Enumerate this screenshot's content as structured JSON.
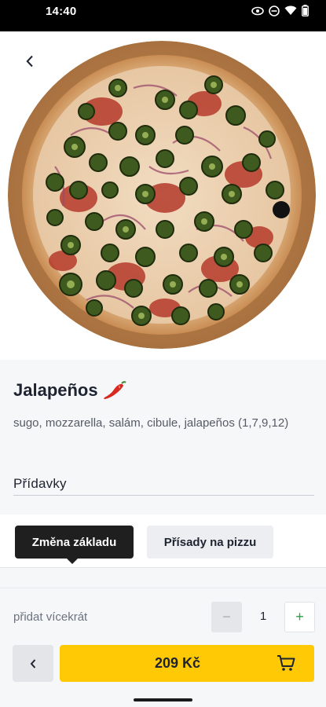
{
  "status_bar": {
    "time": "14:40",
    "icons": [
      "eye-icon",
      "dnd-icon",
      "wifi-icon",
      "battery-icon"
    ]
  },
  "product": {
    "title": "Jalapeños",
    "title_emoji": "chili-pepper-icon",
    "description": "sugo, mozzarella, salám, cibule, jalapeños (1,7,9,12)"
  },
  "extras": {
    "section_label": "Přídavky",
    "tooltip_label": "Změna základu",
    "toppings_label": "Přísady na pizzu"
  },
  "quantity": {
    "label": "přidat vícekrát",
    "value": "1",
    "minus": "−",
    "plus": "+"
  },
  "cart": {
    "price_label": "209 Kč"
  },
  "colors": {
    "accent": "#ffc905",
    "plus_green": "#22a447",
    "tooltip_bg": "#1f1f1f"
  }
}
